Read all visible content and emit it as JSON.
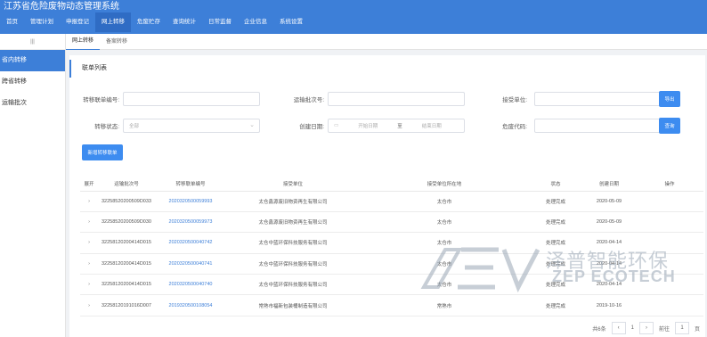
{
  "app": {
    "title": "江苏省危险废物动态管理系统",
    "user_label": ""
  },
  "nav": [
    {
      "label": "首页",
      "active": false
    },
    {
      "label": "管理计划",
      "active": false
    },
    {
      "label": "申报登记",
      "active": false
    },
    {
      "label": "网上转移",
      "active": true
    },
    {
      "label": "危废贮存",
      "active": false
    },
    {
      "label": "查询统计",
      "active": false
    },
    {
      "label": "日常监督",
      "active": false
    },
    {
      "label": "企业信息",
      "active": false
    },
    {
      "label": "系统设置",
      "active": false
    }
  ],
  "sidebar": {
    "collapse_label": "|||",
    "items": [
      {
        "label": "省内转移",
        "active": true
      },
      {
        "label": "跨省转移",
        "active": false
      },
      {
        "label": "运输批次",
        "active": false
      }
    ]
  },
  "tabs": [
    {
      "label": "网上转移",
      "active": true
    },
    {
      "label": "备案转移",
      "active": false
    }
  ],
  "panel": {
    "title": "联单列表"
  },
  "filters": {
    "manifest_no_label": "转移联单编号:",
    "batch_no_label": "运输批次号:",
    "receiver_label": "接受单位:",
    "status_label": "转移状态:",
    "status_value": "全部",
    "date_label": "创建日期:",
    "date_start_placeholder": "开始日期",
    "date_sep": "至",
    "date_end_placeholder": "结束日期",
    "waste_code_label": "危废代码:"
  },
  "buttons": {
    "export": "导出",
    "search": "查询",
    "create": "新增转移联单"
  },
  "table": {
    "headers": [
      "展开",
      "运输批次号",
      "转移联单编号",
      "接受单位",
      "接受单位所在地",
      "状态",
      "创建日期",
      "操作"
    ],
    "rows": [
      {
        "expand": "›",
        "batch": "32258520200509D033",
        "manifest": "2020320500059993",
        "receiver": "太仓鑫源废旧物资再生有限公司",
        "location": "太仓市",
        "status": "处理完成",
        "date": "2020-05-09",
        "action": ""
      },
      {
        "expand": "›",
        "batch": "32258520200509D030",
        "manifest": "2020320500059973",
        "receiver": "太仓鑫源废旧物资再生有限公司",
        "location": "太仓市",
        "status": "处理完成",
        "date": "2020-05-09",
        "action": ""
      },
      {
        "expand": "›",
        "batch": "32258120200414D015",
        "manifest": "2020320500040742",
        "receiver": "太仓中蓝环保科技服务有限公司",
        "location": "太仓市",
        "status": "处理完成",
        "date": "2020-04-14",
        "action": ""
      },
      {
        "expand": "›",
        "batch": "32258120200414D015",
        "manifest": "2020320500040741",
        "receiver": "太仓中蓝环保科技服务有限公司",
        "location": "太仓市",
        "status": "处理完成",
        "date": "2020-04-14",
        "action": ""
      },
      {
        "expand": "›",
        "batch": "32258120200414D015",
        "manifest": "2020320500040740",
        "receiver": "太仓中蓝环保科技服务有限公司",
        "location": "太仓市",
        "status": "处理完成",
        "date": "2020-04-14",
        "action": ""
      },
      {
        "expand": "›",
        "batch": "32258120191016D007",
        "manifest": "2019320500108054",
        "receiver": "常熟市福新包装桶制造有限公司",
        "location": "常熟市",
        "status": "处理完成",
        "date": "2019-10-16",
        "action": ""
      }
    ]
  },
  "pagination": {
    "total": "共6条",
    "prev": "‹",
    "page": "1",
    "next": "›",
    "goto_label": "前往",
    "goto_value": "1",
    "page_suffix": "页"
  },
  "watermark": {
    "cn": "泽普智能环保",
    "en": "ZEP ECOTECH"
  },
  "colors": {
    "brand": "#3d7fd8",
    "button": "#3d8cf0",
    "link": "#3d7fd8"
  }
}
